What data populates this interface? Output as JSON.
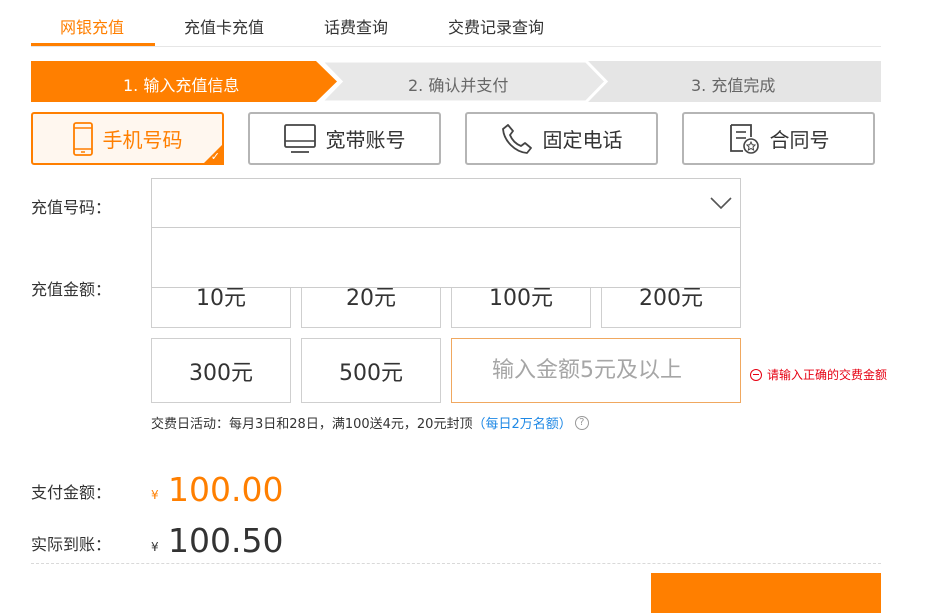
{
  "tabs": [
    {
      "label": "网银充值",
      "active": true
    },
    {
      "label": "充值卡充值",
      "active": false
    },
    {
      "label": "话费查询",
      "active": false
    },
    {
      "label": "交费记录查询",
      "active": false
    }
  ],
  "steps": [
    {
      "label": "1. 输入充值信息",
      "active": true
    },
    {
      "label": "2. 确认并支付",
      "active": false
    },
    {
      "label": "3. 充值完成",
      "active": false
    }
  ],
  "recharge_types": [
    {
      "label": "手机号码",
      "icon": "phone-icon",
      "selected": true
    },
    {
      "label": "宽带账号",
      "icon": "monitor-icon",
      "selected": false
    },
    {
      "label": "固定电话",
      "icon": "telephone-icon",
      "selected": false
    },
    {
      "label": "合同号",
      "icon": "contract-icon",
      "selected": false
    }
  ],
  "form": {
    "number_label": "充值号码：",
    "number_value": "",
    "amount_label": "充值金额：",
    "amounts": [
      "10元",
      "20元",
      "100元",
      "200元",
      "300元",
      "500元"
    ],
    "custom_amount_placeholder": "输入金额5元及以上",
    "error_text": "请输入正确的交费金额",
    "promo_text": "交费日活动：每月3日和28日，满100送4元，20元封顶",
    "promo_link": "（每日2万名额）"
  },
  "summary": {
    "pay_label": "支付金额：",
    "pay_currency": "¥",
    "pay_amount": "100.00",
    "actual_label": "实际到账：",
    "actual_currency": "¥",
    "actual_amount": "100.50"
  },
  "colors": {
    "accent": "#ff7f00",
    "error": "#e60012",
    "link": "#1e88e5",
    "step_inactive": "#e5e5e5"
  }
}
